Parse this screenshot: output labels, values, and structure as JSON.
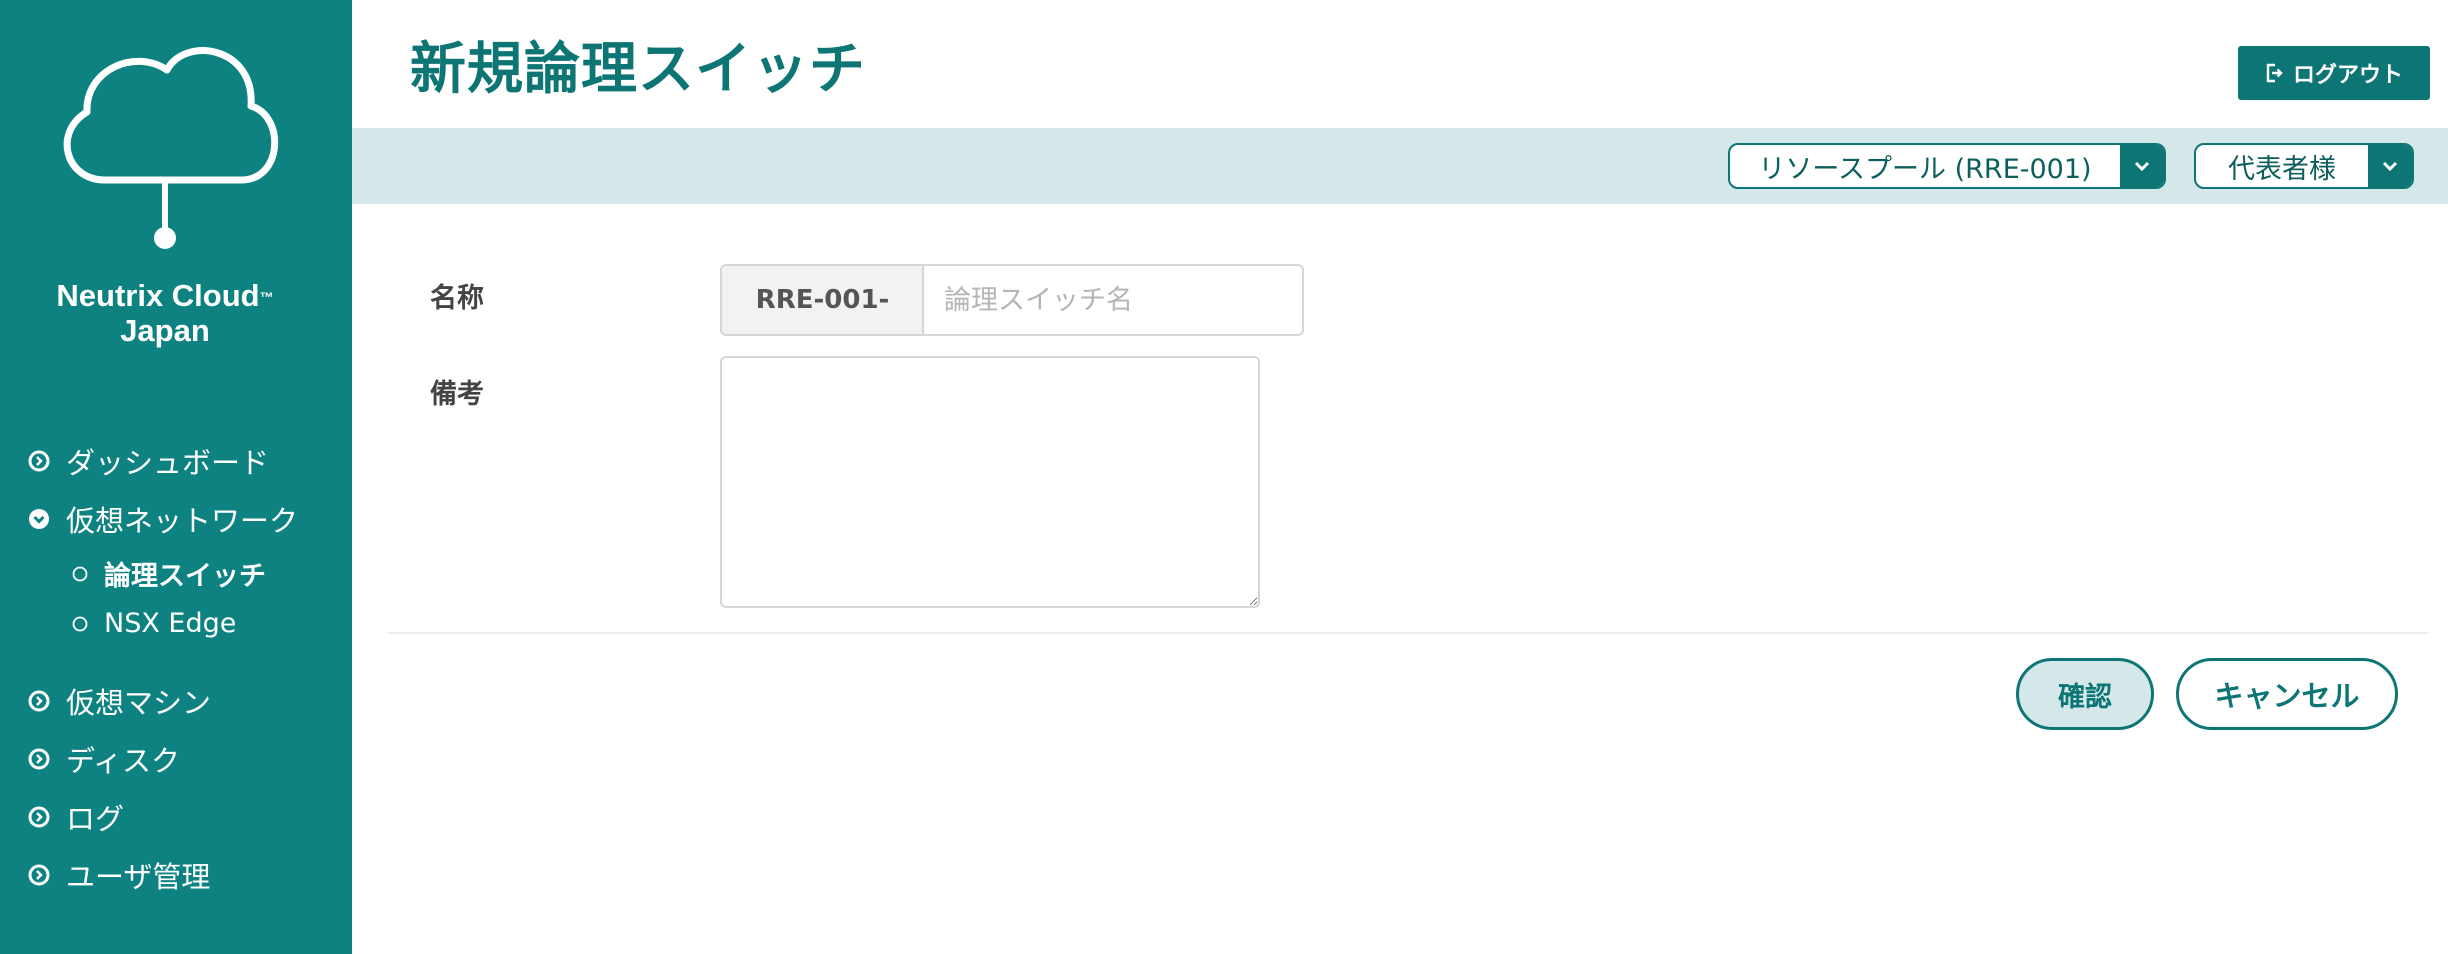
{
  "brand": {
    "line1": "Neutrix Cloud",
    "tm": "™",
    "line2": "Japan"
  },
  "sidebar": {
    "items": [
      {
        "label": "ダッシュボード",
        "icon": "circle-chevron-right-icon",
        "expanded": false
      },
      {
        "label": "仮想ネットワーク",
        "icon": "circle-chevron-down-icon",
        "expanded": true,
        "children": [
          {
            "label": "論理スイッチ",
            "icon": "circle-outline-icon",
            "active": true
          },
          {
            "label": "NSX Edge",
            "icon": "circle-outline-icon",
            "active": false
          }
        ]
      },
      {
        "label": "仮想マシン",
        "icon": "circle-chevron-right-icon",
        "expanded": false
      },
      {
        "label": "ディスク",
        "icon": "circle-chevron-right-icon",
        "expanded": false
      },
      {
        "label": "ログ",
        "icon": "circle-chevron-right-icon",
        "expanded": false
      },
      {
        "label": "ユーザ管理",
        "icon": "circle-chevron-right-icon",
        "expanded": false
      }
    ]
  },
  "header": {
    "title": "新規論理スイッチ",
    "logout_label": "ログアウト",
    "resource_pool": "リソースプール (RRE-001)",
    "user": "代表者様"
  },
  "form": {
    "name_label": "名称",
    "name_prefix": "RRE-001-",
    "name_value": "",
    "name_placeholder": "論理スイッチ名",
    "remarks_label": "備考",
    "remarks_value": ""
  },
  "actions": {
    "confirm_label": "確認",
    "cancel_label": "キャンセル"
  },
  "colors": {
    "sidebar": "#0d8281",
    "accent": "#0d7675",
    "band": "#d4e7e9"
  }
}
